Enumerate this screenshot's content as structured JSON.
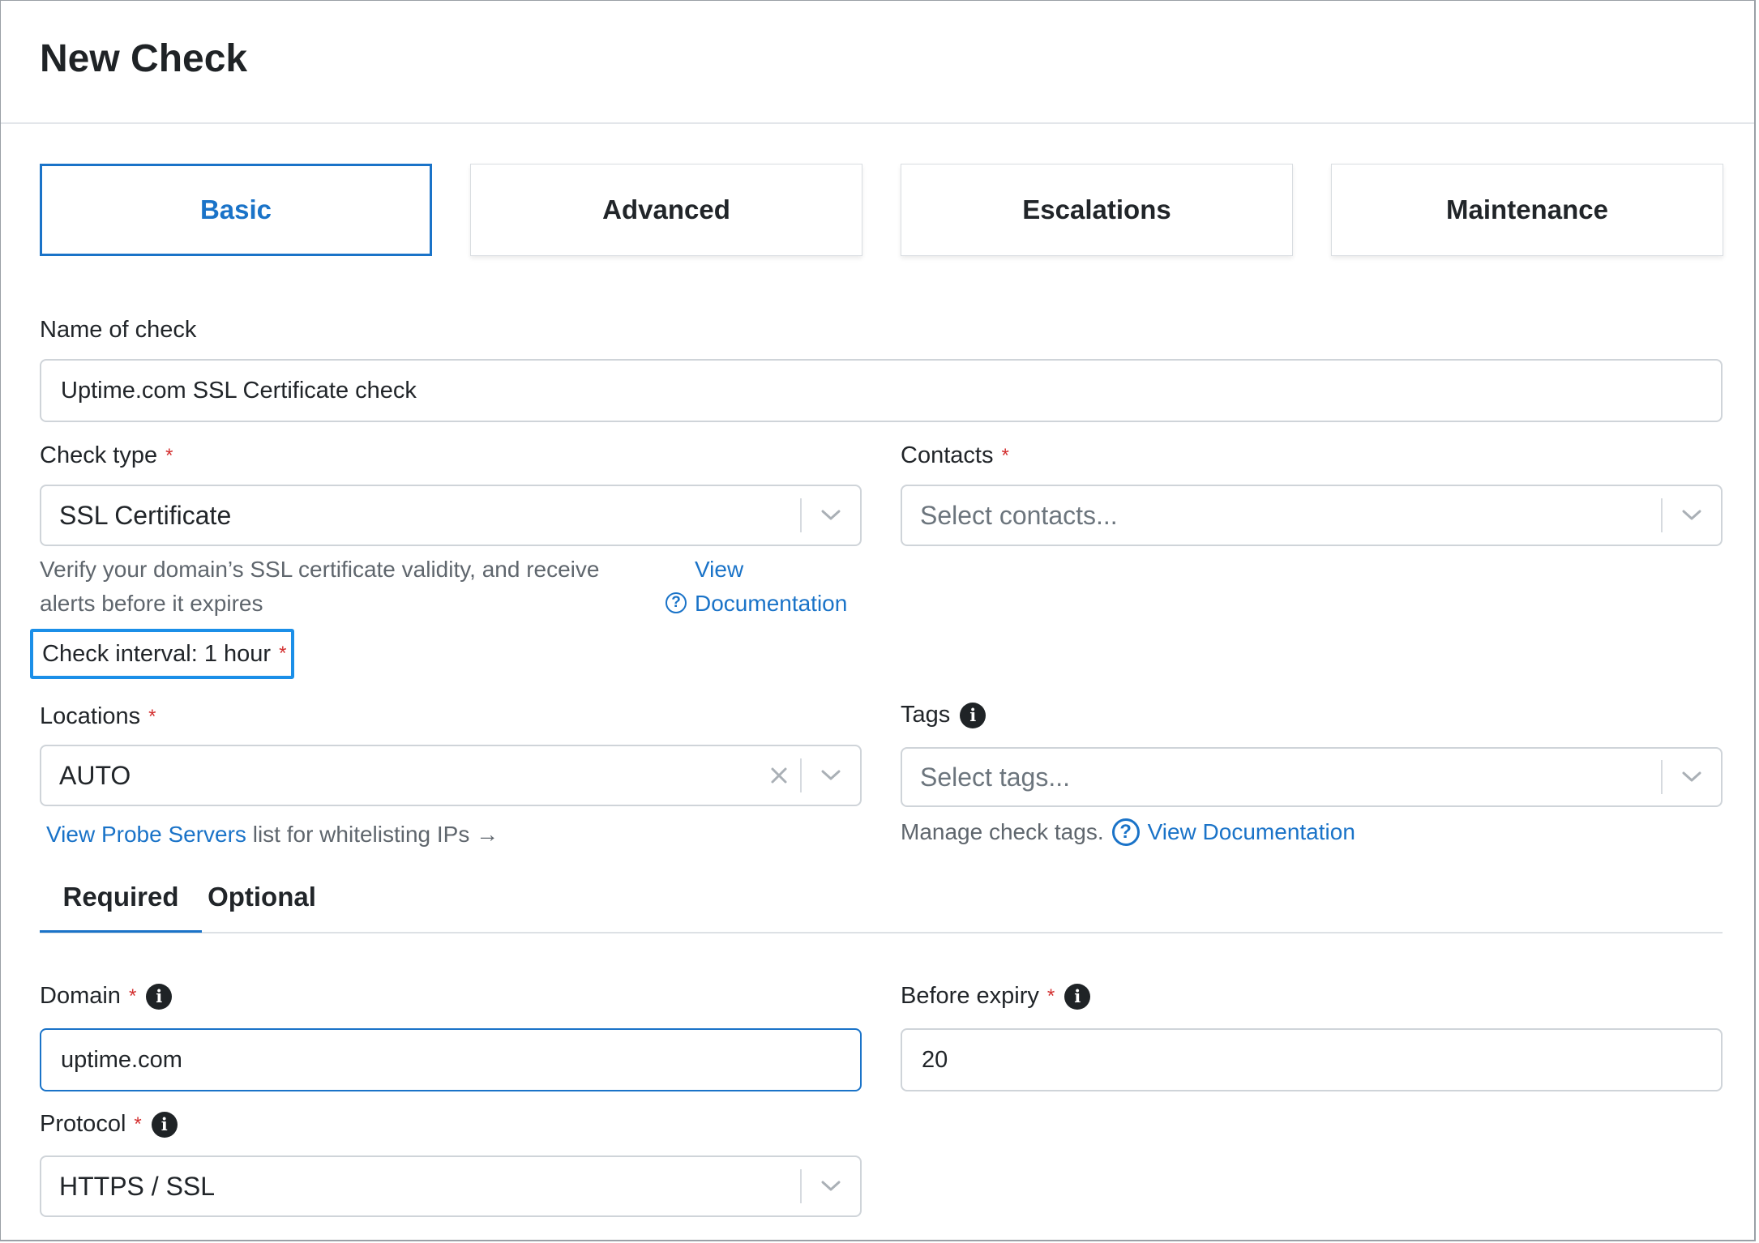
{
  "page": {
    "title": "New Check"
  },
  "tabs": [
    {
      "label": "Basic",
      "active": true
    },
    {
      "label": "Advanced"
    },
    {
      "label": "Escalations"
    },
    {
      "label": "Maintenance"
    }
  ],
  "form": {
    "name": {
      "label": "Name of check",
      "value": "Uptime.com SSL Certificate check"
    },
    "check_type": {
      "label": "Check type",
      "required_mark": "*",
      "value": "SSL Certificate",
      "help": "Verify your domain’s SSL certificate validity, and receive alerts before it expires",
      "doc_link_line1": "View",
      "doc_link_line2": "Documentation",
      "doc_icon": "?"
    },
    "contacts": {
      "label": "Contacts",
      "required_mark": "*",
      "placeholder": "Select contacts..."
    },
    "interval": {
      "label": "Check interval: 1 hour",
      "required_mark": "*"
    },
    "locations": {
      "label": "Locations",
      "required_mark": "*",
      "value": "AUTO",
      "probe_link": "View Probe Servers",
      "probe_text": "list for whitelisting IPs →"
    },
    "tags": {
      "label": "Tags",
      "info_icon": "i",
      "placeholder": "Select tags...",
      "help": "Manage check tags.",
      "doc_icon": "?",
      "doc_link": "View Documentation"
    },
    "subtabs": [
      {
        "label": "Required",
        "active": true
      },
      {
        "label": "Optional"
      }
    ],
    "domain": {
      "label": "Domain",
      "required_mark": "*",
      "info_icon": "i",
      "value": "uptime.com"
    },
    "before_expiry": {
      "label": "Before expiry",
      "required_mark": "*",
      "info_icon": "i",
      "value": "20"
    },
    "protocol": {
      "label": "Protocol",
      "required_mark": "*",
      "info_icon": "i",
      "value": "HTTPS / SSL"
    }
  },
  "colors": {
    "accent": "#1a73c8",
    "required": "#d32f2f",
    "highlight": "#1b8fe8"
  }
}
